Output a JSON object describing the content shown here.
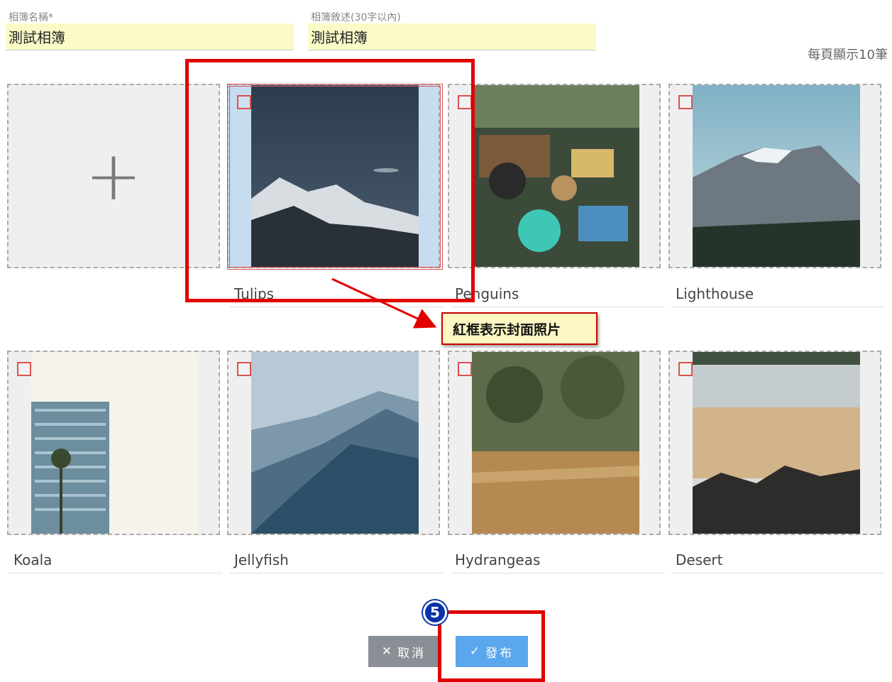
{
  "form": {
    "name_label": "相簿名稱*",
    "name_value": "測試相簿",
    "desc_label": "相簿敘述(30字以內)",
    "desc_value": "測試相簿"
  },
  "per_page_text": "每頁顯示10筆",
  "add_card": {
    "icon": "plus-icon",
    "symbol": "+"
  },
  "photos": [
    {
      "caption": "Tulips",
      "is_cover": true
    },
    {
      "caption": "Penguins"
    },
    {
      "caption": "Lighthouse"
    },
    {
      "caption": "Koala"
    },
    {
      "caption": "Jellyfish"
    },
    {
      "caption": "Hydrangeas"
    },
    {
      "caption": "Desert"
    }
  ],
  "annotation": {
    "callout_text": "紅框表示封面照片",
    "step_number": "5"
  },
  "buttons": {
    "cancel_icon": "✕",
    "cancel_label": "取消",
    "publish_icon": "✓",
    "publish_label": "發布"
  },
  "colors": {
    "annotation_red": "#e00000",
    "input_bg": "#fbfbc8",
    "publish_blue": "#5ba7ee",
    "cancel_gray": "#8a8f96"
  }
}
